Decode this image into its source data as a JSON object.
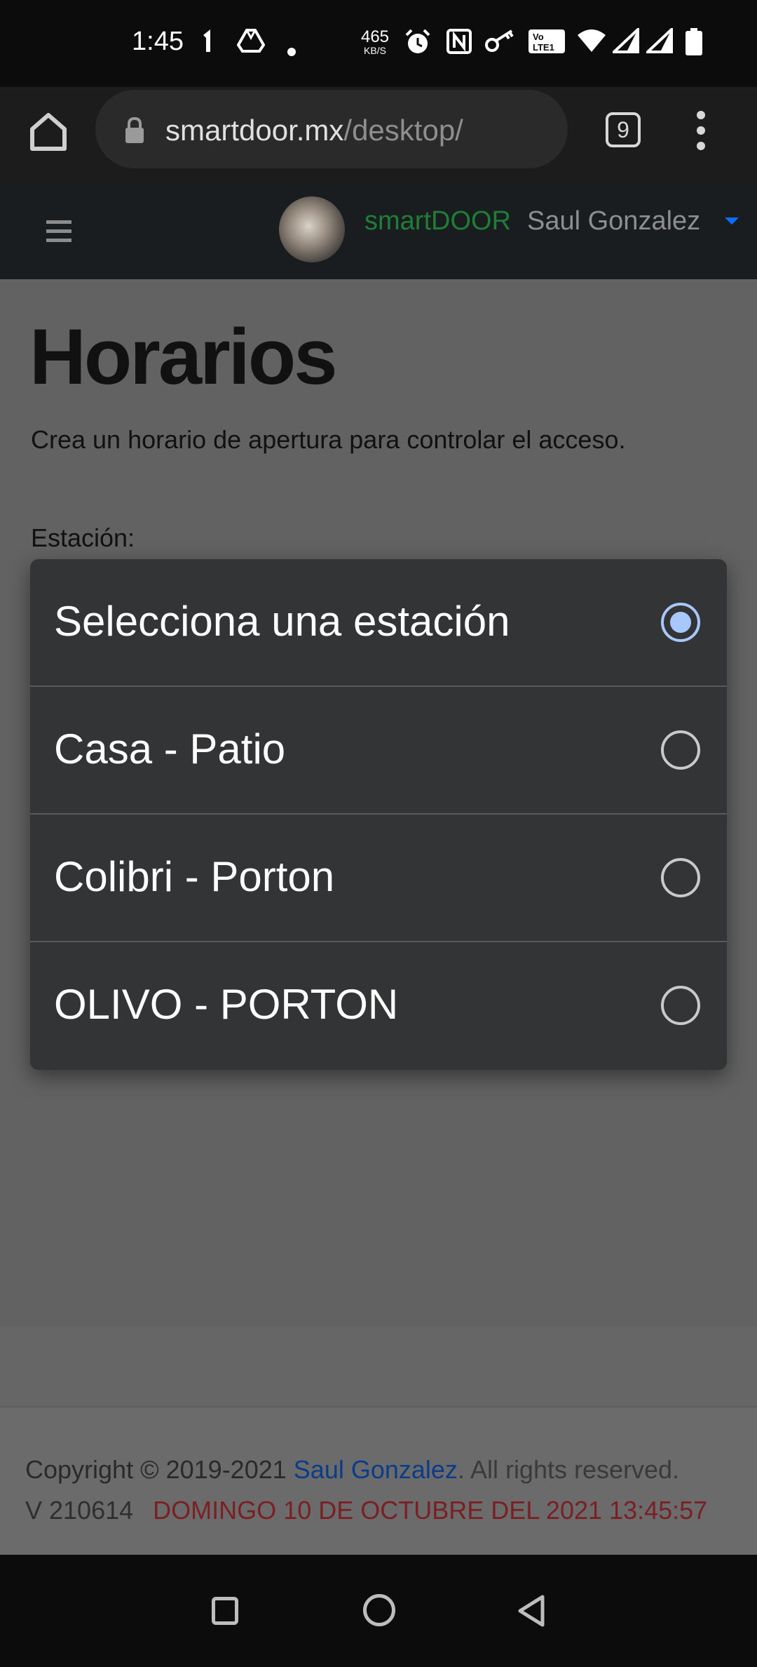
{
  "status_bar": {
    "time": "1:45",
    "net_speed_value": "465",
    "net_speed_unit": "KB/S",
    "icons": [
      "data-arrow-icon",
      "drive-icon",
      "dot-icon",
      "alarm-icon",
      "nfc-icon",
      "key-icon",
      "volte-icon",
      "wifi-icon",
      "signal-icon",
      "signal-icon",
      "battery-icon"
    ]
  },
  "browser": {
    "url_domain": "smartdoor.mx",
    "url_path": "/desktop/",
    "tab_count": "9"
  },
  "navbar": {
    "brand": "smartDOOR",
    "user_name": "Saul Gonzalez",
    "brand_color": "#1f7d35",
    "caret_color": "#0d6efd"
  },
  "page": {
    "title": "Horarios",
    "subtitle": "Crea un horario de apertura para controlar el acceso.",
    "station_label": "Estación:"
  },
  "select_dialog": {
    "options": [
      {
        "label": "Selecciona una estación",
        "selected": true
      },
      {
        "label": "Casa - Patio",
        "selected": false
      },
      {
        "label": "Colibri - Porton",
        "selected": false
      },
      {
        "label": "OLIVO - PORTON",
        "selected": false
      }
    ],
    "accent_color": "#a8c7fa"
  },
  "footer": {
    "copyright_prefix": "Copyright © 2019-2021",
    "author": "Saul Gonzalez",
    "rights": ". All rights reserved.",
    "version": "V 210614",
    "datetime": "DOMINGO 10 DE OCTUBRE DEL 2021 13:45:57"
  }
}
